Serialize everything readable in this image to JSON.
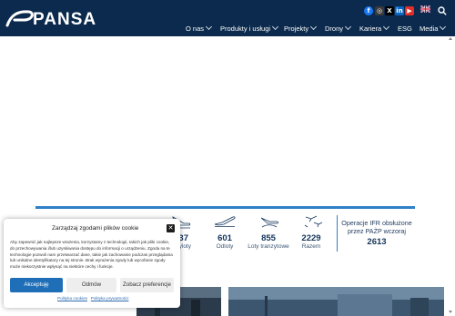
{
  "header": {
    "logo_text": "PANSA",
    "nav": [
      {
        "label": "O nas"
      },
      {
        "label": "Produkty i usługi"
      },
      {
        "label": "Projekty"
      },
      {
        "label": "Drony"
      },
      {
        "label": "Kariera"
      },
      {
        "label": "ESG"
      },
      {
        "label": "Media"
      }
    ],
    "social": [
      "facebook-icon",
      "instagram-icon",
      "x-icon",
      "linkedin-icon",
      "youtube-icon"
    ],
    "language_flag": "uk-flag-icon",
    "search_icon": "search-icon"
  },
  "stats": {
    "items": [
      {
        "number": "37",
        "label": "Przyloty",
        "icon": "plane-landing-icon",
        "visible_label": "yloty"
      },
      {
        "number": "601",
        "label": "Odloty",
        "icon": "plane-departure-icon"
      },
      {
        "number": "855",
        "label": "Loty tranzytowe",
        "icon": "plane-transit-icon"
      },
      {
        "number": "2229",
        "label": "Razem",
        "icon": "planes-total-icon"
      }
    ],
    "ifr_label": "Operacje IFR obsłużone przez PAŻP wczoraj",
    "ifr_value": "2613"
  },
  "cookie": {
    "title": "Zarządzaj zgodami plików cookie",
    "text": "Aby zapewnić jak najlepsze wrażenia, korzystamy z technologii, takich jak pliki cookie, do przechowywania i/lub uzyskiwania dostępu do informacji o urządzeniu. Zgoda na te technologie pozwoli nam przetwarzać dane, takie jak zachowanie podczas przeglądania lub unikalne identyfikatory na tej stronie. Brak wyrażenia zgody lub wycofanie zgody może niekorzystnie wpłynąć na niektóre cechy i funkcje.",
    "accept": "Akceptuję",
    "reject": "Odmów",
    "preferences": "Zobacz preferencje",
    "link_cookies": "Polityka cookies",
    "link_privacy": "Polityka prywatności"
  },
  "colors": {
    "header_bg": "#0b2a4d",
    "accent": "#2f80c8",
    "accept_bg": "#1f6fb8"
  }
}
